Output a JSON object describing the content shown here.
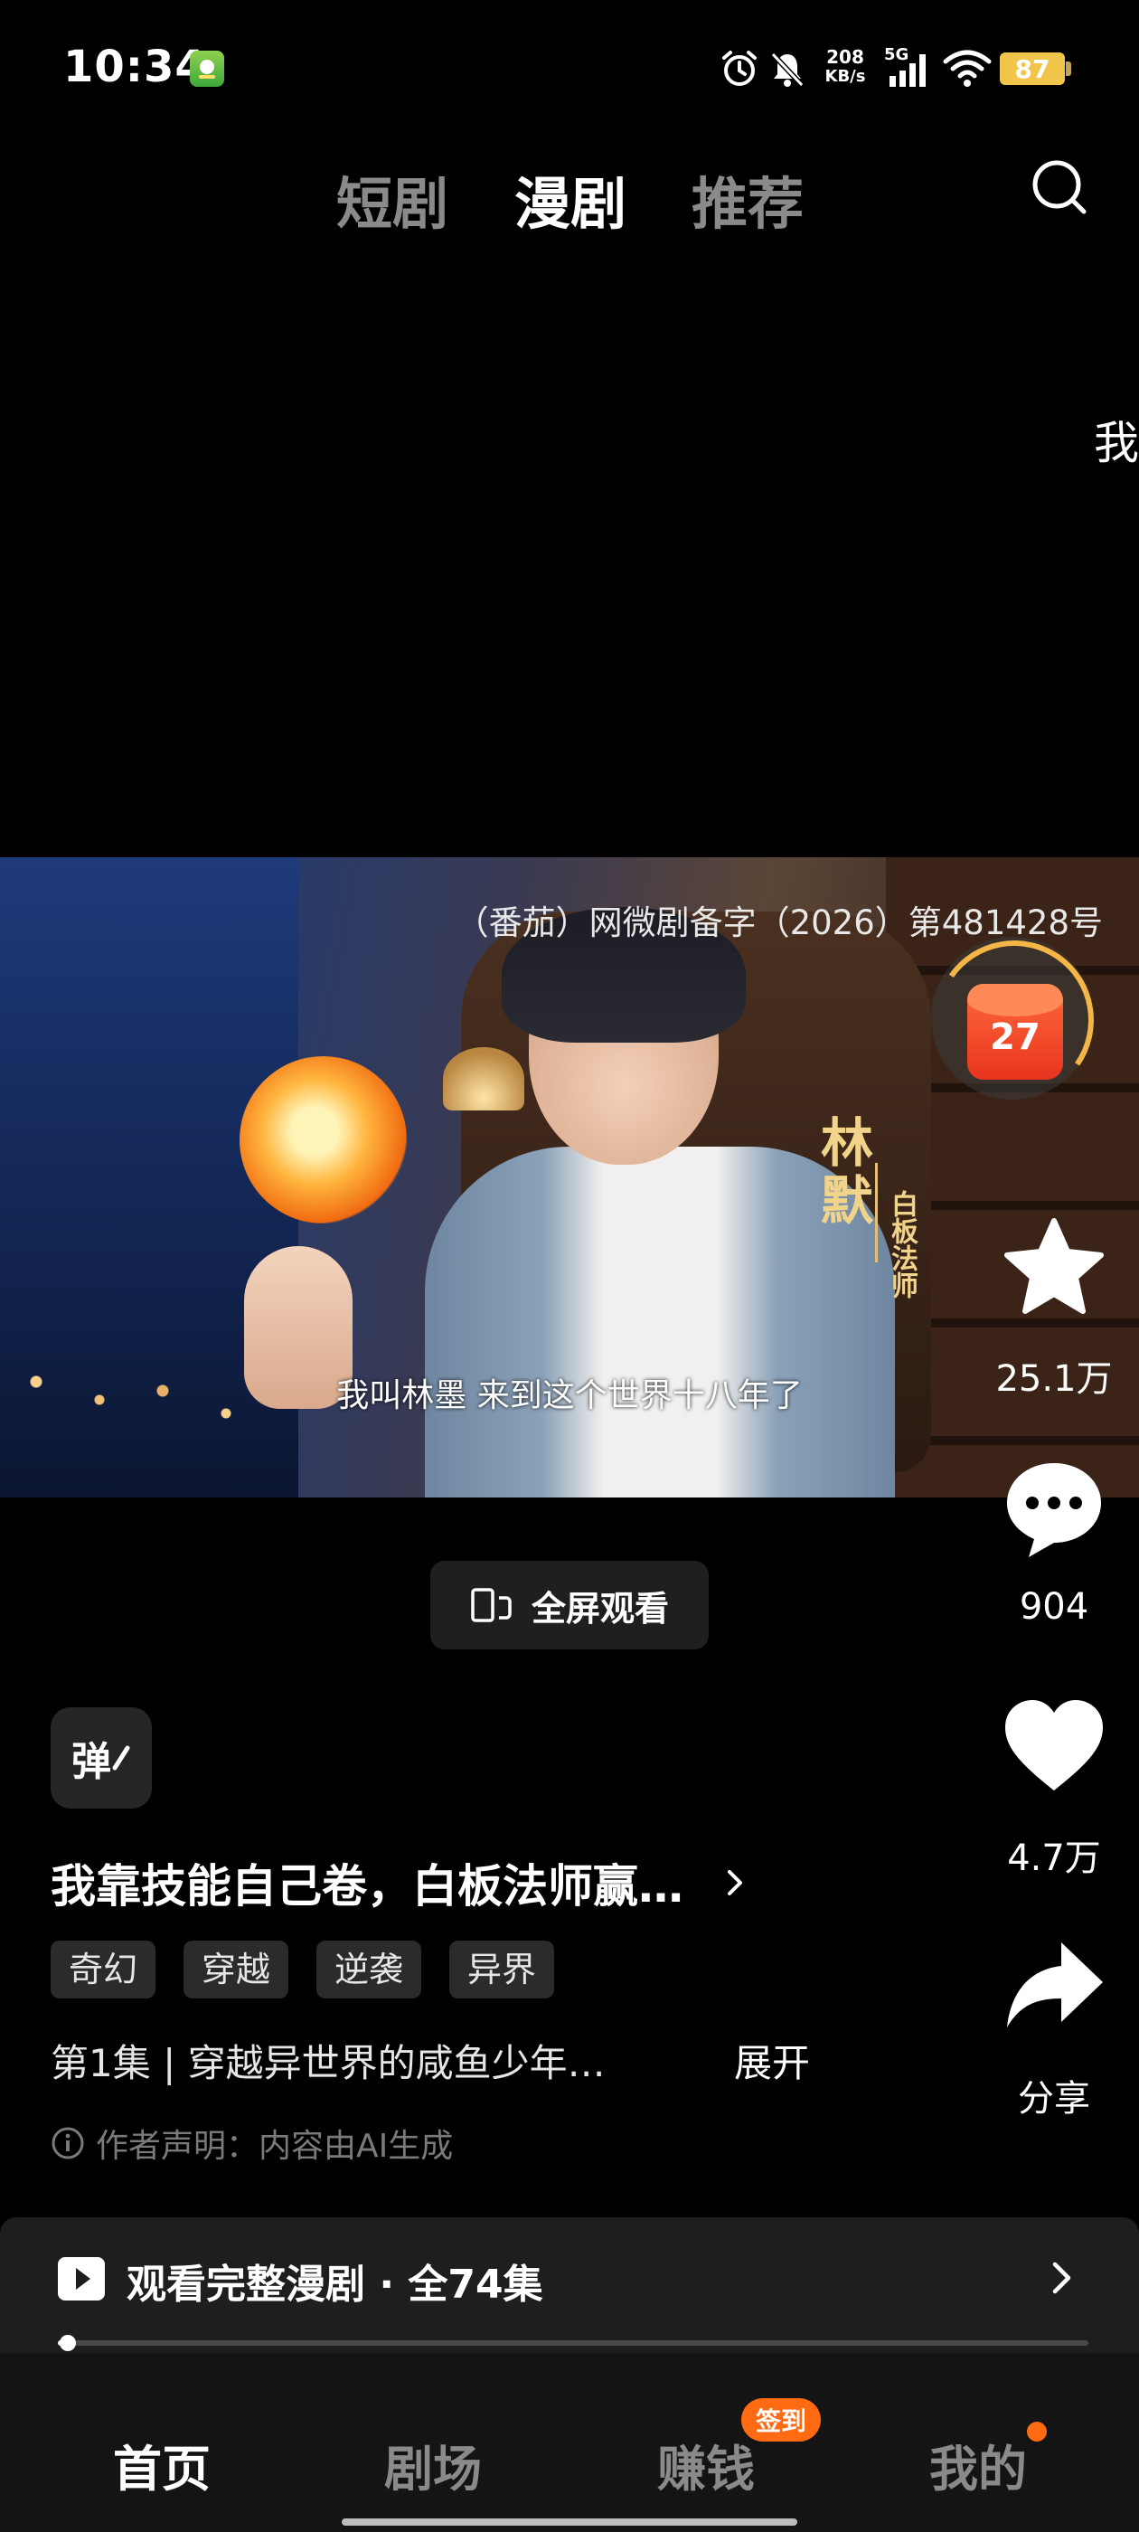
{
  "status_bar": {
    "time": "10:34",
    "net_speed_value": "208",
    "net_speed_unit": "KB/s",
    "network_type": "5G",
    "battery_level": "87",
    "icons": [
      "alarm-icon",
      "mute-icon",
      "signal-icon",
      "wifi-icon",
      "battery-icon"
    ]
  },
  "top_tabs": {
    "items": [
      {
        "label": "短剧",
        "active": false
      },
      {
        "label": "漫剧",
        "active": true
      },
      {
        "label": "推荐",
        "active": false
      }
    ],
    "search_icon": "search-icon"
  },
  "floating_char": "我",
  "video": {
    "registration": "（番茄）网微剧备字（2026）第481428号",
    "character_name": "林默",
    "character_title": "白板法师",
    "subtitle": "我叫林墨 来到这个世界十八年了"
  },
  "red_packet": {
    "count": "27",
    "icon": "red-packet-icon"
  },
  "actions": {
    "favorite": {
      "icon": "star-icon",
      "count": "25.1万"
    },
    "comment": {
      "icon": "comment-icon",
      "count": "904"
    },
    "like": {
      "icon": "heart-icon",
      "count": "4.7万"
    },
    "share": {
      "icon": "share-icon",
      "label": "分享"
    }
  },
  "fullscreen": {
    "label": "全屏观看",
    "icon": "rotate-screen-icon"
  },
  "danmu": {
    "label": "弹"
  },
  "drama": {
    "title": "我靠技能自己卷，白板法师赢…",
    "tags": [
      "奇幻",
      "穿越",
      "逆袭",
      "异界"
    ],
    "episode_desc": "第1集 | 穿越异世界的咸鱼少年…",
    "expand_label": "展开",
    "ai_note": "作者声明：内容由AI生成"
  },
  "series_bar": {
    "label": "观看完整漫剧 · 全74集",
    "progress": 0.01
  },
  "bottom_nav": {
    "items": [
      {
        "label": "首页",
        "active": true
      },
      {
        "label": "剧场",
        "active": false
      },
      {
        "label": "赚钱",
        "active": false
      },
      {
        "label": "我的",
        "active": false
      }
    ],
    "badge": "签到"
  },
  "colors": {
    "background": "#000000",
    "accent_orange": "#ff6a13",
    "name_gold": "#f2d38a"
  }
}
